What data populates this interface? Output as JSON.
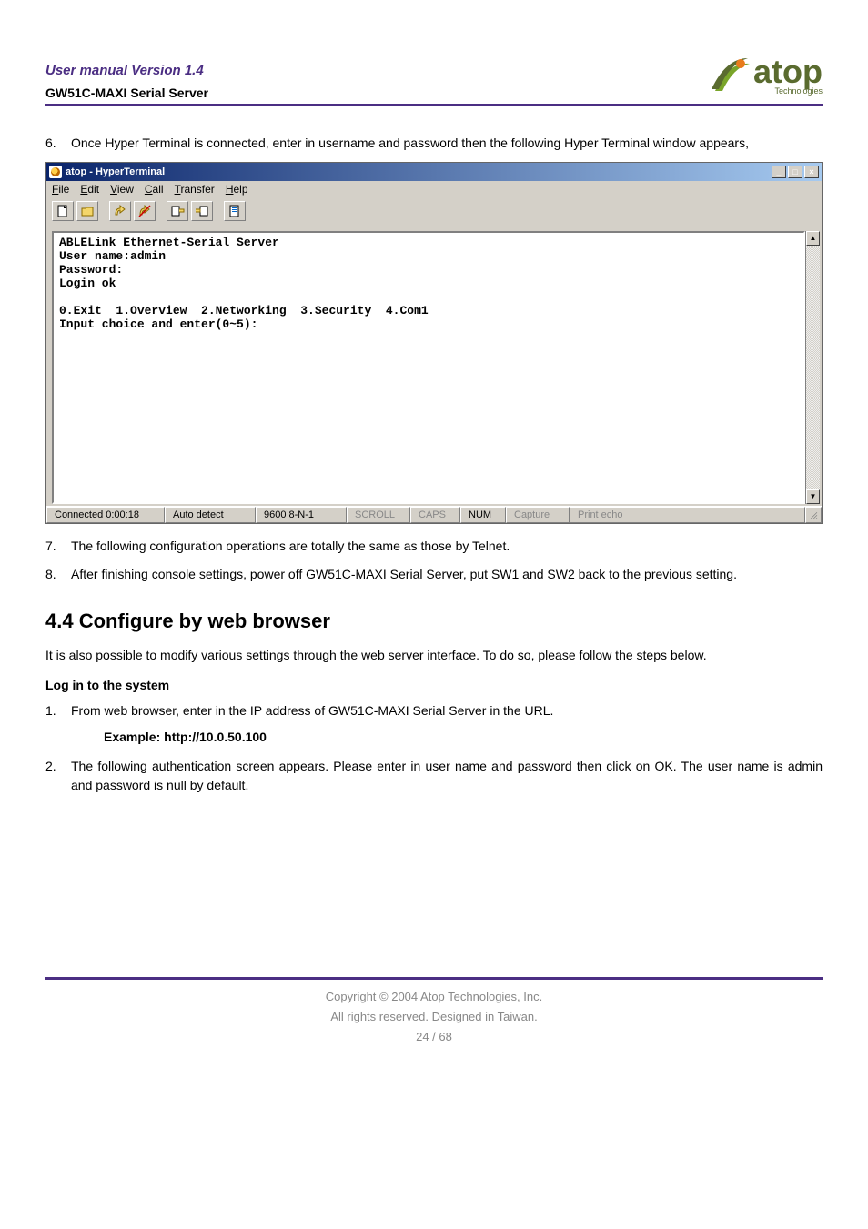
{
  "header": {
    "manual_version": "User manual Version 1.4",
    "product": "GW51C-MAXI Serial Server",
    "logo_text": "atop",
    "logo_sub": "Technologies"
  },
  "list1": {
    "item6_num": "6.",
    "item6_text": "Once Hyper Terminal is connected, enter in username and password then the following Hyper Terminal window appears,"
  },
  "ht": {
    "title": "atop - HyperTerminal",
    "menus": {
      "file": "File",
      "edit": "Edit",
      "view": "View",
      "call": "Call",
      "transfer": "Transfer",
      "help": "Help"
    },
    "terminal_text": "ABLELink Ethernet-Serial Server\nUser name:admin\nPassword:\nLogin ok\n\n0.Exit  1.Overview  2.Networking  3.Security  4.Com1\nInput choice and enter(0~5):",
    "status": {
      "connected": "Connected 0:00:18",
      "detect": "Auto detect",
      "baud": "9600 8-N-1",
      "scroll": "SCROLL",
      "caps": "CAPS",
      "num": "NUM",
      "capture": "Capture",
      "echo": "Print echo"
    }
  },
  "list2": {
    "item7_num": "7.",
    "item7_text": "The following configuration operations are totally the same as those by Telnet.",
    "item8_num": "8.",
    "item8_text": "After finishing console settings, power off GW51C-MAXI Serial Server, put SW1 and SW2 back to the previous setting."
  },
  "section": {
    "heading": "4.4 Configure by web browser",
    "intro": "It is also possible to modify various settings through the web server interface. To do so, please follow the steps below.",
    "login_head": "Log in to the system",
    "step1_num": "1.",
    "step1_text": "From web browser, enter in the IP address of GW51C-MAXI Serial Server in the URL.",
    "example": "Example: http://10.0.50.100",
    "step2_num": "2.",
    "step2_text": "The following authentication screen appears. Please enter in user name and password then click on OK. The user name is admin and password is null by default."
  },
  "footer": {
    "copyright": "Copyright © 2004 Atop Technologies, Inc.",
    "rights": "All rights reserved. Designed in Taiwan.",
    "page": "24 / 68"
  }
}
